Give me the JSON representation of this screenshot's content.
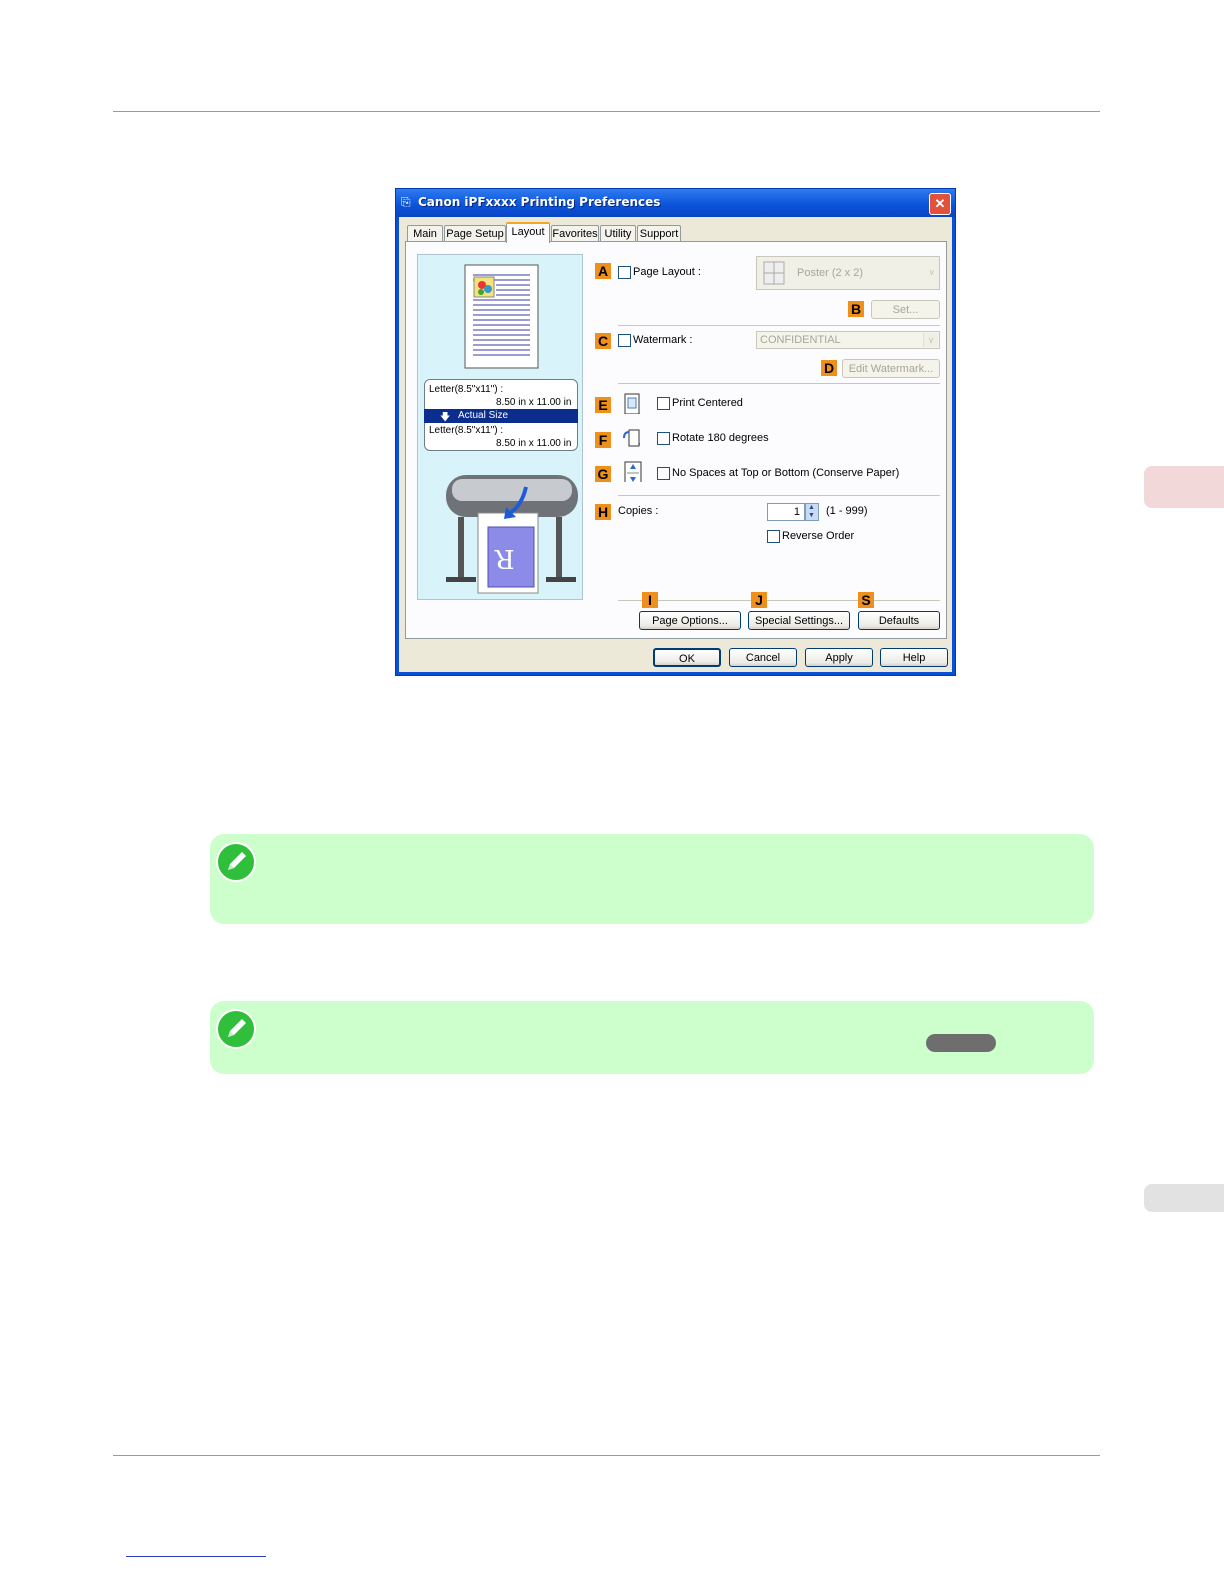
{
  "dialog": {
    "title": "Canon iPFxxxx Printing Preferences",
    "close_glyph": "✕",
    "tabs": [
      "Main",
      "Page Setup",
      "Layout",
      "Favorites",
      "Utility",
      "Support"
    ],
    "active_tab": "Layout",
    "preview": {
      "size_line1": "Letter(8.5\"x11\") :",
      "size_line2": "8.50 in x 11.00 in",
      "scale_label": "Actual Size",
      "size_line3": "Letter(8.5\"x11\") :",
      "size_line4": "8.50 in x 11.00 in",
      "sample_letter": "R"
    },
    "markers": {
      "A": "A",
      "B": "B",
      "C": "C",
      "D": "D",
      "E": "E",
      "F": "F",
      "G": "G",
      "H": "H",
      "I": "I",
      "J": "J",
      "S": "S"
    },
    "page_layout": {
      "label": "Page Layout :",
      "value": "Poster (2 x 2)",
      "set_button": "Set..."
    },
    "watermark": {
      "label": "Watermark :",
      "value": "CONFIDENTIAL",
      "edit_button": "Edit Watermark..."
    },
    "print_centered": {
      "label": "Print Centered"
    },
    "rotate": {
      "label": "Rotate 180 degrees"
    },
    "no_spaces": {
      "label": "No Spaces at Top or Bottom (Conserve Paper)"
    },
    "copies": {
      "label": "Copies :",
      "value": "1",
      "range": "(1 - 999)",
      "reverse_label": "Reverse Order"
    },
    "buttons": {
      "page_options": "Page Options...",
      "special_settings": "Special Settings...",
      "defaults": "Defaults",
      "ok": "OK",
      "cancel": "Cancel",
      "apply": "Apply",
      "help": "Help"
    }
  },
  "colors": {
    "note_bg": "#ccffcc",
    "marker": "#f0901c",
    "titlebar": "#0a52d9",
    "side_tab": "#f2d8d8"
  }
}
